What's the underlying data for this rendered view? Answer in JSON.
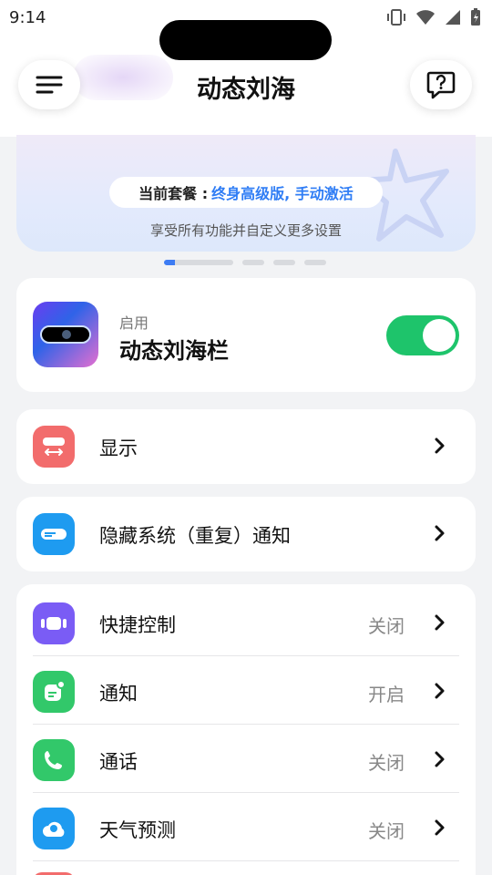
{
  "status": {
    "time": "9:14"
  },
  "header": {
    "title": "动态刘海"
  },
  "banner": {
    "plan_label": "当前套餐 :",
    "plan_value": "终身高级版, 手动激活",
    "subtitle": "享受所有功能并自定义更多设置"
  },
  "main_card": {
    "enable_label": "启用",
    "name": "动态刘海栏",
    "enabled": true
  },
  "rows": {
    "display": {
      "label": "显示",
      "icon": "display-icon",
      "color": "#f26c6c"
    },
    "hide_notif": {
      "label": "隐藏系统（重复）通知",
      "icon": "notification-bar-icon",
      "color": "#1e9bf0"
    }
  },
  "list": [
    {
      "label": "快捷控制",
      "value": "关闭",
      "icon": "quick-control-icon",
      "color": "#7a5cf5"
    },
    {
      "label": "通知",
      "value": "开启",
      "icon": "notification-icon",
      "color": "#32c86a"
    },
    {
      "label": "通话",
      "value": "关闭",
      "icon": "phone-icon",
      "color": "#32c86a"
    },
    {
      "label": "天气预测",
      "value": "关闭",
      "icon": "weather-icon",
      "color": "#1e9bf0"
    }
  ],
  "colors": {
    "accent": "#2f7df5",
    "toggle_on": "#1ec46b"
  }
}
